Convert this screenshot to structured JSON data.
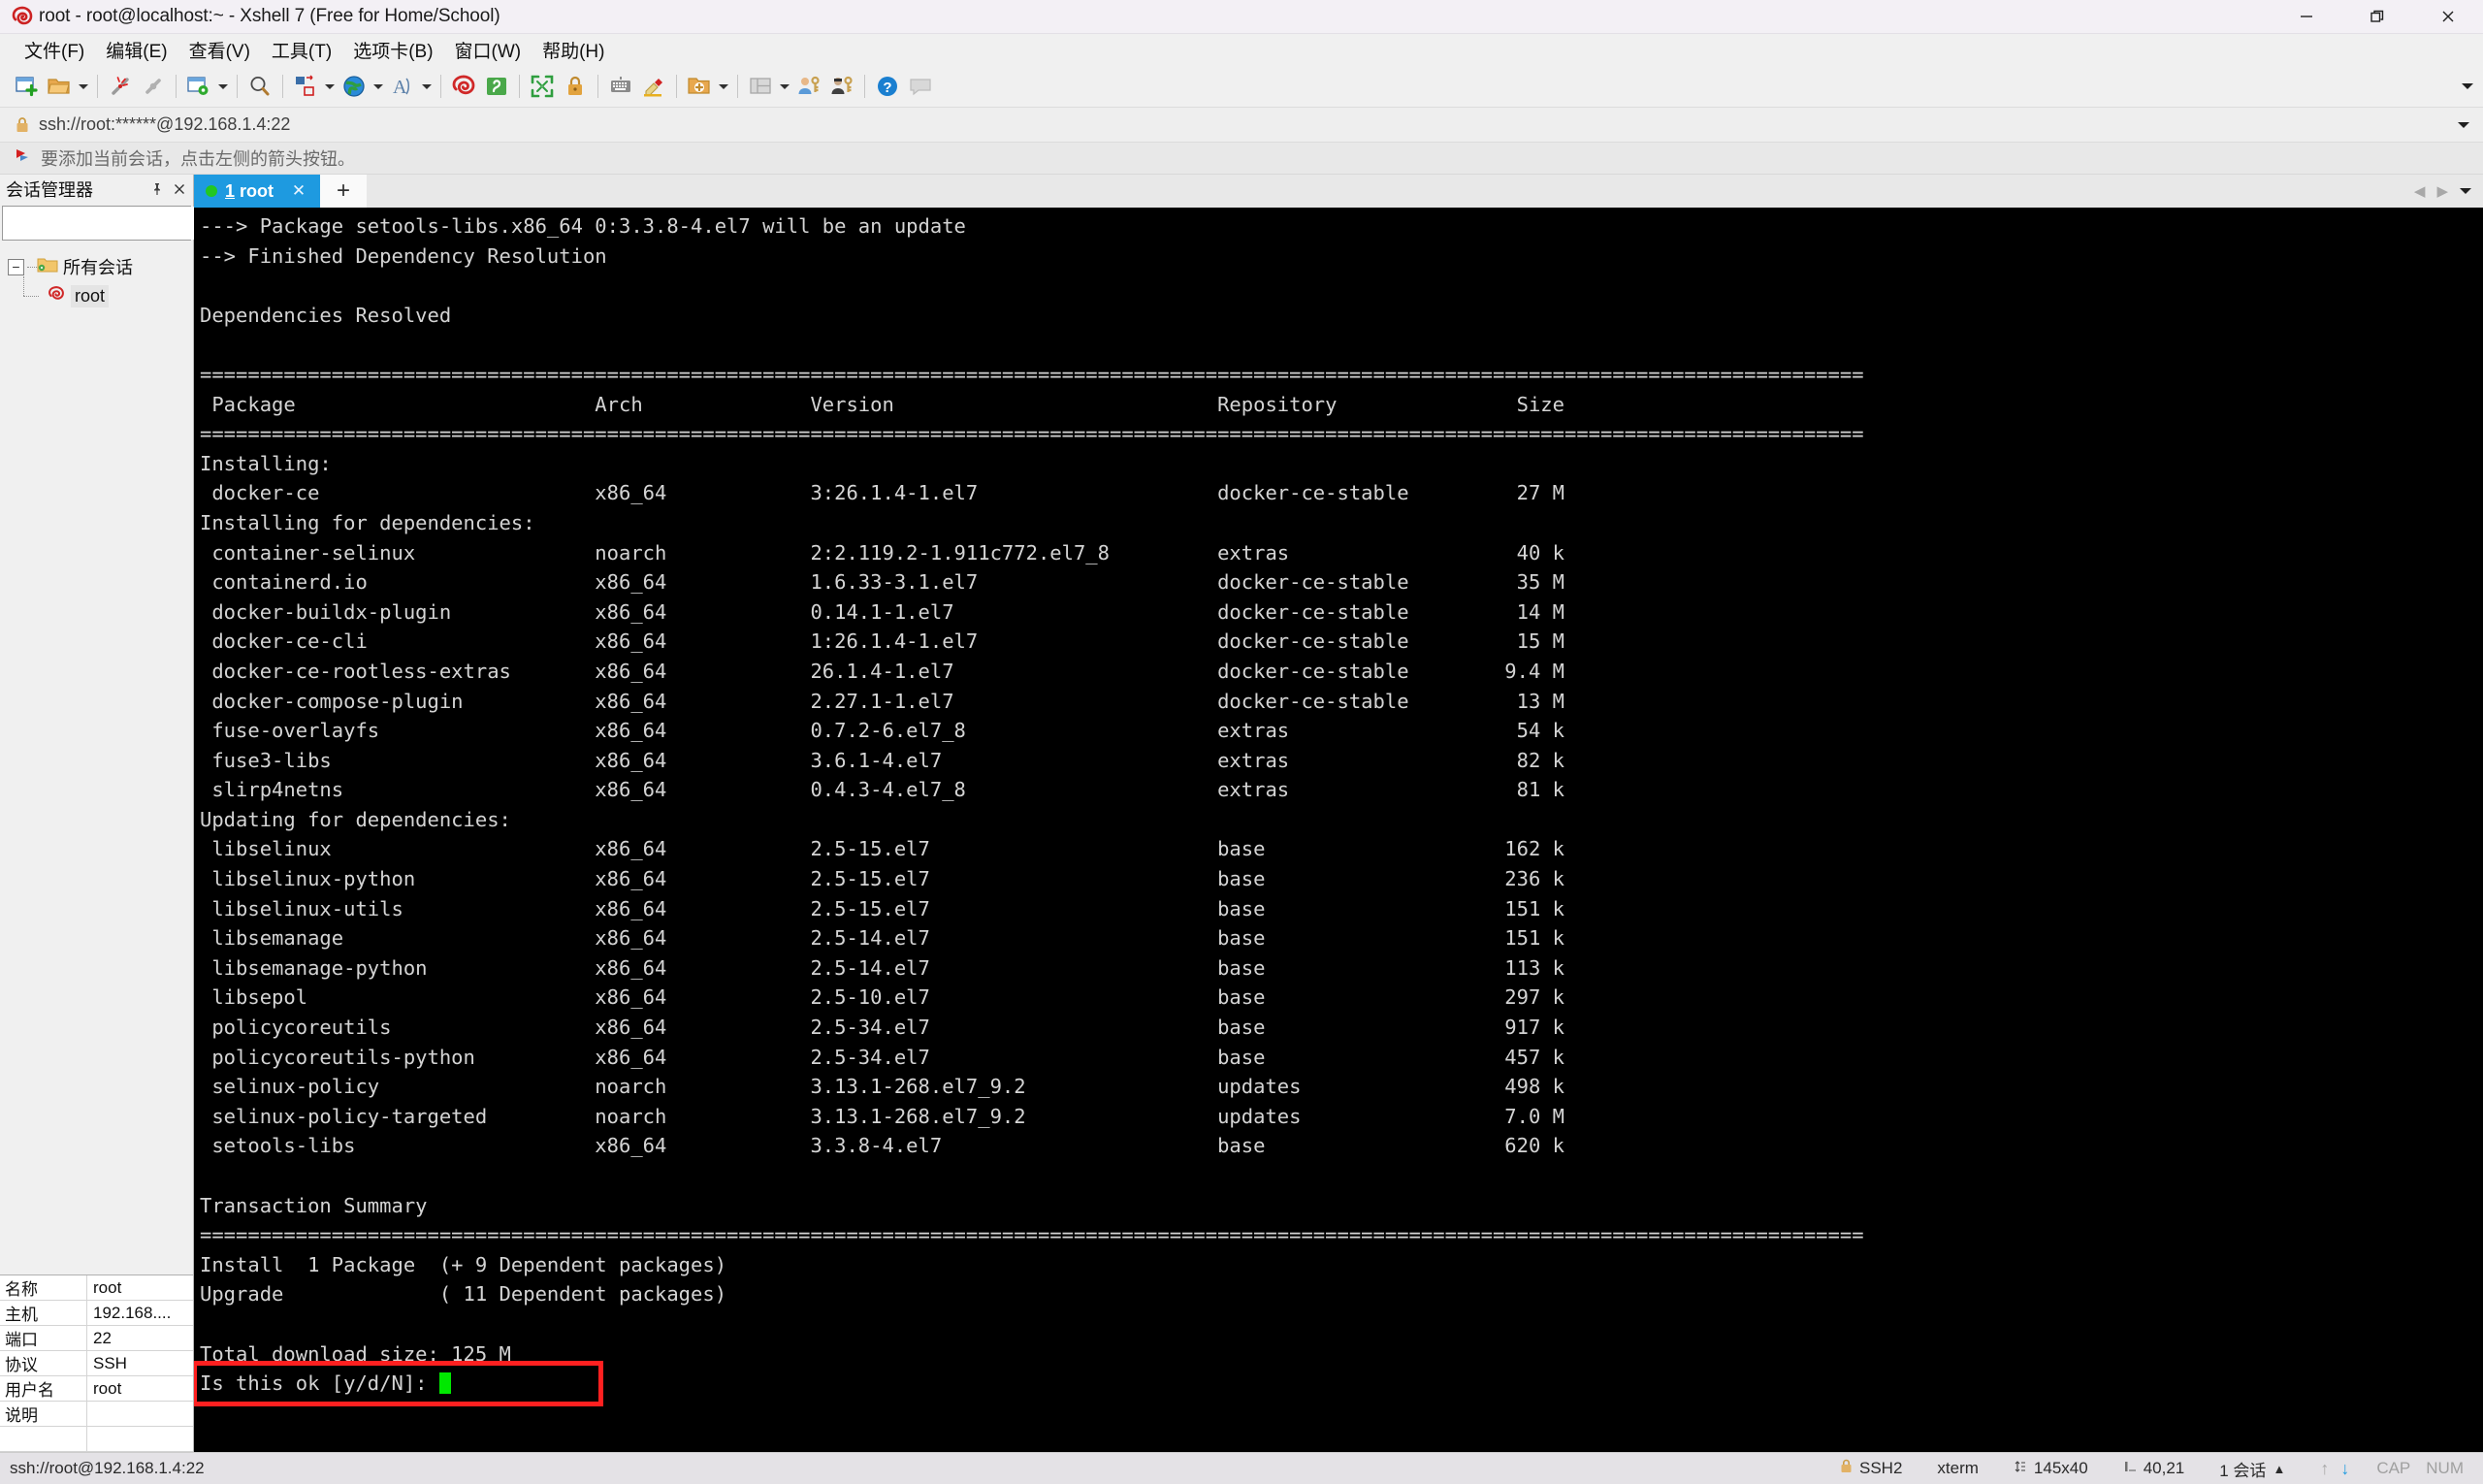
{
  "window": {
    "title": "root - root@localhost:~ - Xshell 7 (Free for Home/School)",
    "minimize_label": "—",
    "restore_label": "❐",
    "close_label": "✕"
  },
  "menubar": {
    "items": [
      {
        "label": "文件(F)",
        "name": "menu-file"
      },
      {
        "label": "编辑(E)",
        "name": "menu-edit"
      },
      {
        "label": "查看(V)",
        "name": "menu-view"
      },
      {
        "label": "工具(T)",
        "name": "menu-tools"
      },
      {
        "label": "选项卡(B)",
        "name": "menu-tabs"
      },
      {
        "label": "窗口(W)",
        "name": "menu-window"
      },
      {
        "label": "帮助(H)",
        "name": "menu-help"
      }
    ]
  },
  "addressbar": {
    "lock_icon": "lock-icon",
    "value": "ssh://root:******@192.168.1.4:22"
  },
  "notice": {
    "text": "要添加当前会话，点击左侧的箭头按钮。"
  },
  "sidebar": {
    "title": "会话管理器",
    "pin_label": "📌",
    "close_label": "✕",
    "search_placeholder": "",
    "search_value": "",
    "tree": {
      "root_label": "所有会话",
      "expander": "−",
      "children": [
        {
          "label": "root"
        }
      ]
    },
    "properties": [
      {
        "key": "名称",
        "value": "root"
      },
      {
        "key": "主机",
        "value": "192.168...."
      },
      {
        "key": "端口",
        "value": "22"
      },
      {
        "key": "协议",
        "value": "SSH"
      },
      {
        "key": "用户名",
        "value": "root"
      },
      {
        "key": "说明",
        "value": ""
      },
      {
        "key": "",
        "value": ""
      }
    ]
  },
  "tabs": {
    "active": {
      "label_prefix": "1",
      "label": " root",
      "close": "✕"
    },
    "new_tab_label": "+"
  },
  "terminal": {
    "accent_green": "#00e800",
    "fg": "#d4d4d4",
    "bg": "#000000",
    "separator": "================================================================================================================================================================",
    "lines": [
      "---> Package setools-libs.x86_64 0:3.3.8-4.el7 will be an update",
      "--> Finished Dependency Resolution",
      "",
      "Dependencies Resolved",
      "",
      "===========================================================================================================================================",
      " Package                         Arch              Version                           Repository               Size",
      "===========================================================================================================================================",
      "Installing:",
      " docker-ce                       x86_64            3:26.1.4-1.el7                    docker-ce-stable         27 M",
      "Installing for dependencies:",
      " container-selinux               noarch            2:2.119.2-1.911c772.el7_8         extras                   40 k",
      " containerd.io                   x86_64            1.6.33-3.1.el7                    docker-ce-stable         35 M",
      " docker-buildx-plugin            x86_64            0.14.1-1.el7                      docker-ce-stable         14 M",
      " docker-ce-cli                   x86_64            1:26.1.4-1.el7                    docker-ce-stable         15 M",
      " docker-ce-rootless-extras       x86_64            26.1.4-1.el7                      docker-ce-stable        9.4 M",
      " docker-compose-plugin           x86_64            2.27.1-1.el7                      docker-ce-stable         13 M",
      " fuse-overlayfs                  x86_64            0.7.2-6.el7_8                     extras                   54 k",
      " fuse3-libs                      x86_64            3.6.1-4.el7                       extras                   82 k",
      " slirp4netns                     x86_64            0.4.3-4.el7_8                     extras                   81 k",
      "Updating for dependencies:",
      " libselinux                      x86_64            2.5-15.el7                        base                    162 k",
      " libselinux-python               x86_64            2.5-15.el7                        base                    236 k",
      " libselinux-utils                x86_64            2.5-15.el7                        base                    151 k",
      " libsemanage                     x86_64            2.5-14.el7                        base                    151 k",
      " libsemanage-python              x86_64            2.5-14.el7                        base                    113 k",
      " libsepol                        x86_64            2.5-10.el7                        base                    297 k",
      " policycoreutils                 x86_64            2.5-34.el7                        base                    917 k",
      " policycoreutils-python          x86_64            2.5-34.el7                        base                    457 k",
      " selinux-policy                  noarch            3.13.1-268.el7_9.2                updates                 498 k",
      " selinux-policy-targeted         noarch            3.13.1-268.el7_9.2                updates                 7.0 M",
      " setools-libs                    x86_64            3.3.8-4.el7                       base                    620 k",
      "",
      "Transaction Summary",
      "===========================================================================================================================================",
      "Install  1 Package  (+ 9 Dependent packages)",
      "Upgrade             ( 11 Dependent packages)",
      "",
      "Total download size: 125 M"
    ],
    "prompt": "Is this ok [y/d/N]: ",
    "cursor": "block-cursor",
    "annotation_color": "#ff2020"
  },
  "statusbar": {
    "left": "ssh://root@192.168.1.4:22",
    "connection": "SSH2",
    "term_type": "xterm",
    "size": "145x40",
    "cursor_pos": "40,21",
    "sessions": "1 会话",
    "caps": "CAP",
    "num": "NUM"
  }
}
